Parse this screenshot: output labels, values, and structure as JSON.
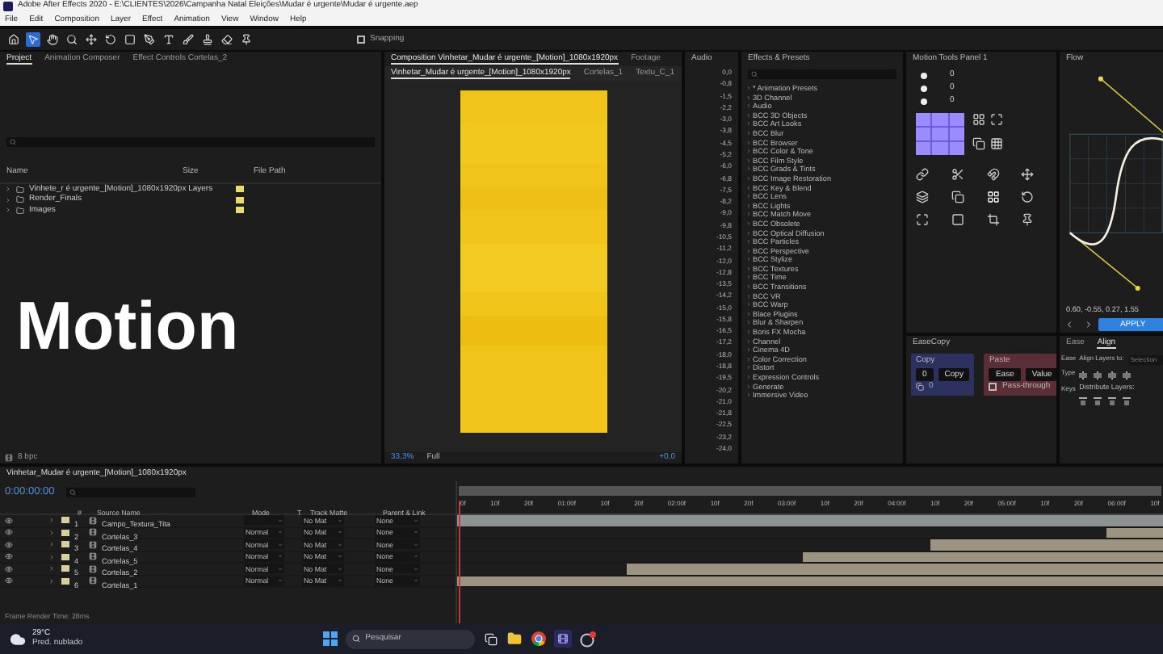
{
  "window": {
    "title": "Adobe After Effects 2020 - E:\\CLIENTES\\2026\\Campanha Natal Eleições\\Mudar é urgente\\Mudar é urgente.aep"
  },
  "menu": [
    "File",
    "Edit",
    "Composition",
    "Layer",
    "Effect",
    "Animation",
    "View",
    "Window",
    "Help"
  ],
  "toolbar": {
    "tools": [
      {
        "kind": "home",
        "selected": false
      },
      {
        "kind": "select",
        "selected": true
      },
      {
        "kind": "hand",
        "selected": false
      },
      {
        "kind": "zoom",
        "selected": false
      },
      {
        "kind": "move",
        "selected": false
      },
      {
        "kind": "rotate",
        "selected": false
      },
      {
        "kind": "rect",
        "selected": false
      },
      {
        "kind": "pen",
        "selected": false
      },
      {
        "kind": "text",
        "selected": false
      },
      {
        "kind": "brush",
        "selected": false
      },
      {
        "kind": "stamp",
        "selected": false
      },
      {
        "kind": "eraser",
        "selected": false
      },
      {
        "kind": "pin",
        "selected": false
      }
    ],
    "snapping": {
      "label": "Snapping",
      "checked": false
    }
  },
  "project": {
    "tabs": [
      {
        "label": "Project",
        "selected": true
      },
      {
        "label": "Animation Composer",
        "selected": false
      },
      {
        "label": "Effect Controls Cortelas_2",
        "selected": false
      }
    ],
    "columns": [
      "Name",
      "Size",
      "File Path"
    ],
    "items": [
      {
        "name": "Vinhete_r é urgente_[Motion]_1080x1920px Layers"
      },
      {
        "name": "Render_Finals"
      },
      {
        "name": "Images"
      }
    ],
    "bpc": "8 bpc"
  },
  "overlay_text": "Motion",
  "composition": {
    "tabs": [
      {
        "label": "Composition Vinhetar_Mudar é urgente_[Motion]_1080x1920px",
        "selected": true
      },
      {
        "label": "Footage",
        "selected": false
      }
    ],
    "subtabs": [
      {
        "label": "Vinhetar_Mudar é urgente_[Motion]_1080x1920px",
        "selected": true
      },
      {
        "label": "Cortelas_1",
        "selected": false
      },
      {
        "label": "Textu_C_1",
        "selected": false
      }
    ],
    "zoom": "33,3%",
    "resolution": "Full",
    "exposure": "+0,0"
  },
  "audio": {
    "title": "Audio",
    "scale": [
      "0,0",
      "-0,8",
      "-1,5",
      "-2,2",
      "-3,0",
      "-3,8",
      "-4,5",
      "-5,2",
      "-6,0",
      "-6,8",
      "-7,5",
      "-8,2",
      "-9,0",
      "-9,8",
      "-10,5",
      "-11,2",
      "-12,0",
      "-12,8",
      "-13,5",
      "-14,2",
      "-15,0",
      "-15,8",
      "-16,5",
      "-17,2",
      "-18,0",
      "-18,8",
      "-19,5",
      "-20,2",
      "-21,0",
      "-21,8",
      "-22,5",
      "-23,2",
      "-24,0"
    ]
  },
  "effects": {
    "title": "Effects & Presets",
    "items": [
      "* Animation Presets",
      "3D Channel",
      "Audio",
      "BCC 3D Objects",
      "BCC Art Looks",
      "BCC Blur",
      "BCC Browser",
      "BCC Color & Tone",
      "BCC Film Style",
      "BCC Grads & Tints",
      "BCC Image Restoration",
      "BCC Key & Blend",
      "BCC Lens",
      "BCC Lights",
      "BCC Match Move",
      "BCC Obsolete",
      "BCC Optical Diffusion",
      "BCC Particles",
      "BCC Perspective",
      "BCC Stylize",
      "BCC Textures",
      "BCC Time",
      "BCC Transitions",
      "BCC VR",
      "BCC Warp",
      "Blace Plugins",
      "Blur & Sharpen",
      "Boris FX Mocha",
      "Channel",
      "Cinema 4D",
      "Color Correction",
      "Distort",
      "Expression Controls",
      "Generate",
      "Immersive Video"
    ]
  },
  "motion_tools": {
    "title": "Motion Tools Panel 1",
    "values": [
      "0",
      "0",
      "0"
    ]
  },
  "flow": {
    "title": "Flow",
    "values": "0.60, -0.55, 0.27, 1.55",
    "apply": "APPLY"
  },
  "easecopy": {
    "title": "EaseCopy",
    "copy_title": "Copy",
    "copy_value": "0",
    "copy_button": "Copy",
    "copy_count": "0",
    "paste_title": "Paste",
    "paste_buttons": [
      "Ease",
      "Value"
    ],
    "pass_through": {
      "label": "Pass-through",
      "checked": false
    }
  },
  "align": {
    "tabs": [
      {
        "label": "Ease",
        "selected": false
      },
      {
        "label": "Align",
        "selected": true
      }
    ],
    "row_labels": [
      "Ease",
      "Type",
      "Keys"
    ],
    "align_to": "Align Layers to:",
    "align_target": "Selection",
    "distribute": "Distribute Layers:"
  },
  "timeline": {
    "title": "Vinhetar_Mudar é urgente_[Motion]_1080x1920px",
    "timecode": "0:00:00:00",
    "columns": [
      "#",
      "Source Name",
      "Mode",
      "T",
      "Track Matte",
      "Parent & Link"
    ],
    "layers": [
      {
        "index": "1",
        "name": "Campo_Textura_Tita",
        "matte": "No Mat",
        "parent": "None",
        "level": 1,
        "color": "#8c9392"
      },
      {
        "index": "2",
        "name": "Cortelas_3",
        "mode": "Normal",
        "matte": "No Mat",
        "parent": "None",
        "level": 0.08,
        "color": "#9c9480"
      },
      {
        "index": "3",
        "name": "Cortelas_4",
        "mode": "Normal",
        "matte": "No Mat",
        "parent": "None",
        "level": 0.33,
        "color": "#9c9480"
      },
      {
        "index": "4",
        "name": "Cortelas_5",
        "mode": "Normal",
        "matte": "No Mat",
        "parent": "None",
        "level": 0.51,
        "color": "#9c9480"
      },
      {
        "index": "5",
        "name": "Cortelas_2",
        "mode": "Normal",
        "matte": "No Mat",
        "parent": "None",
        "level": 0.76,
        "color": "#9c9480"
      },
      {
        "index": "6",
        "name": "Cortelas_1",
        "mode": "Normal",
        "matte": "No Mat",
        "parent": "None",
        "level": 1,
        "color": "#9c9480"
      }
    ],
    "ruler": [
      "0f",
      "10f",
      "20f",
      "01:00f",
      "10f",
      "20f",
      "02:00f",
      "10f",
      "20f",
      "03:00f",
      "10f",
      "20f",
      "04:00f",
      "10f",
      "20f",
      "05:00f",
      "10f",
      "20f",
      "06:00f",
      "10f"
    ],
    "render_time": "Frame Render Time: 28ms"
  },
  "taskbar": {
    "temperature": "29°C",
    "weather": "Pred. nublado",
    "search_placeholder": "Pesquisar"
  }
}
